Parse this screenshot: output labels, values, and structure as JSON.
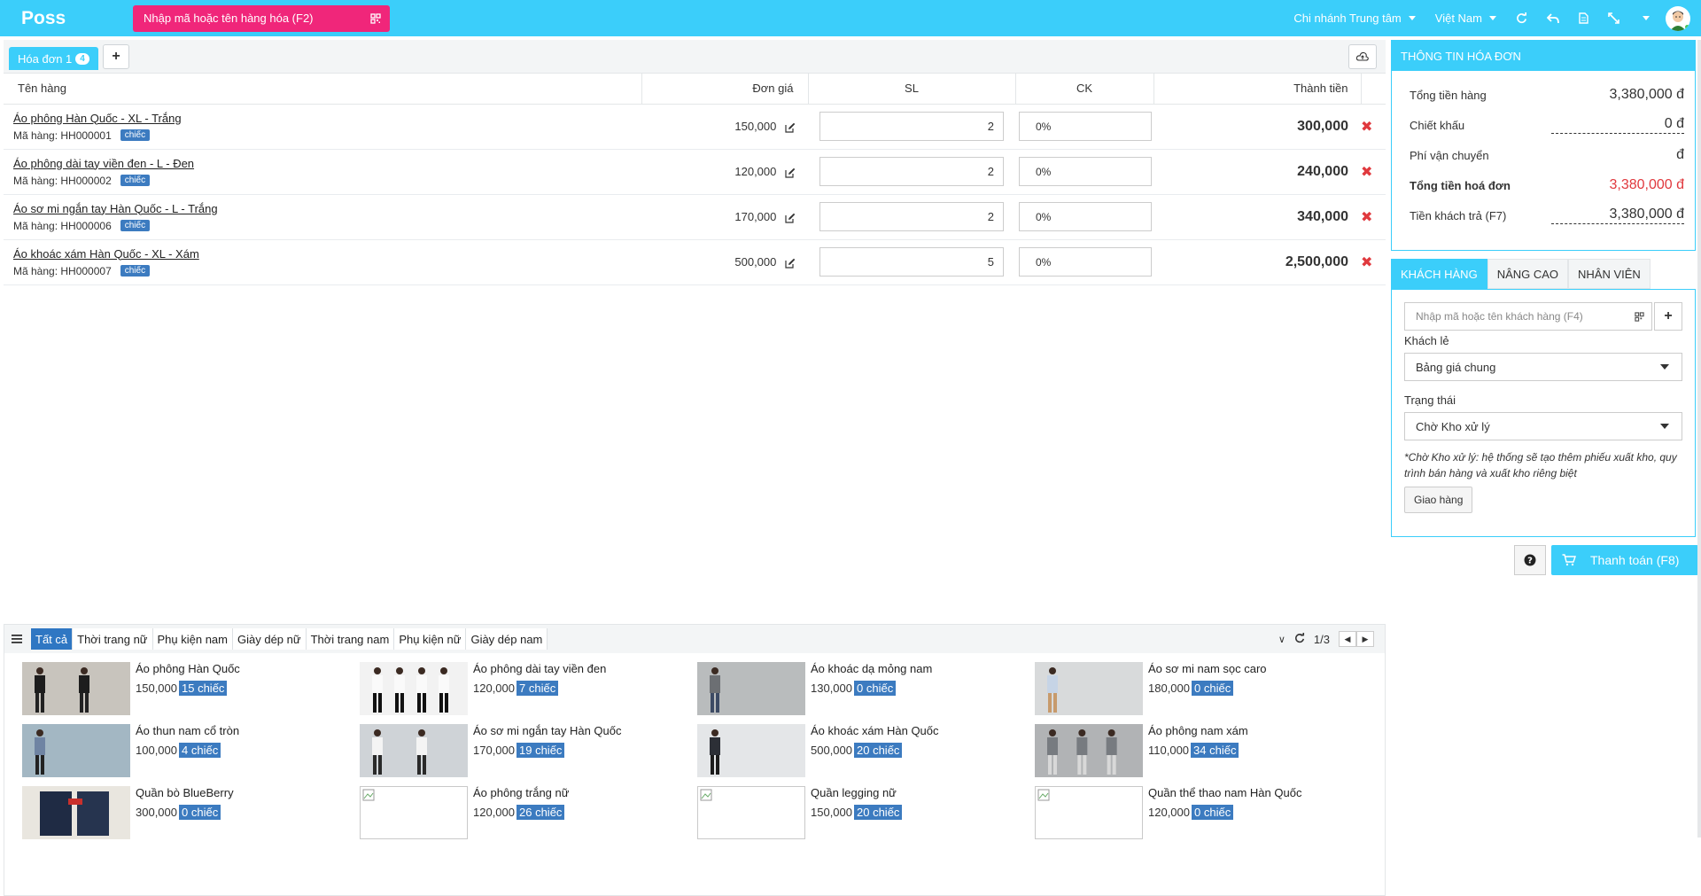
{
  "header": {
    "logo": "Poss",
    "search_placeholder": "Nhập mã hoặc tên hàng hóa (F2)",
    "branch": "Chi nhánh Trung tâm",
    "language": "Việt Nam",
    "icons": [
      "refresh-icon",
      "undo-icon",
      "document-icon",
      "fullscreen-icon",
      "dropdown-icon"
    ]
  },
  "invoice_tab": {
    "label": "Hóa đơn 1",
    "count": "4"
  },
  "cart": {
    "columns": {
      "name": "Tên hàng",
      "price": "Đơn giá",
      "qty": "SL",
      "discount": "CK",
      "total": "Thành tiền"
    },
    "rows": [
      {
        "name": "Áo phông Hàn Quốc - XL - Trắng",
        "code": "Mã hàng: HH000001",
        "unit": "chiếc",
        "price": "150,000",
        "qty": "2",
        "discount": "0%",
        "total": "300,000"
      },
      {
        "name": "Áo phông dài tay viền đen - L - Đen",
        "code": "Mã hàng: HH000002",
        "unit": "chiếc",
        "price": "120,000",
        "qty": "2",
        "discount": "0%",
        "total": "240,000"
      },
      {
        "name": "Áo sơ mi ngắn tay Hàn Quốc - L - Trắng",
        "code": "Mã hàng: HH000006",
        "unit": "chiếc",
        "price": "170,000",
        "qty": "2",
        "discount": "0%",
        "total": "340,000"
      },
      {
        "name": "Áo khoác xám Hàn Quốc - XL - Xám",
        "code": "Mã hàng: HH000007",
        "unit": "chiếc",
        "price": "500,000",
        "qty": "5",
        "discount": "0%",
        "total": "2,500,000"
      }
    ]
  },
  "categories": {
    "items": [
      "Tất cả",
      "Thời trang nữ",
      "Phụ kiện nam",
      "Giày dép nữ",
      "Thời trang nam",
      "Phụ kiện nữ",
      "Giày dép nam"
    ],
    "active": 0,
    "page": "1/3"
  },
  "products": [
    {
      "name": "Áo phông Hàn Quốc",
      "price": "150,000",
      "stock": "15 chiếc",
      "image": "photo-1"
    },
    {
      "name": "Áo phông dài tay viền đen",
      "price": "120,000",
      "stock": "7 chiếc",
      "image": "photo-2"
    },
    {
      "name": "Áo khoác dạ mỏng nam",
      "price": "130,000",
      "stock": "0 chiếc",
      "image": "photo-3"
    },
    {
      "name": "Áo sơ mi nam sọc caro",
      "price": "180,000",
      "stock": "0 chiếc",
      "image": "photo-4"
    },
    {
      "name": "Áo thun nam cổ tròn",
      "price": "100,000",
      "stock": "4 chiếc",
      "image": "photo-5"
    },
    {
      "name": "Áo sơ mi ngắn tay Hàn Quốc",
      "price": "170,000",
      "stock": "19 chiếc",
      "image": "photo-6"
    },
    {
      "name": "Áo khoác xám Hàn Quốc",
      "price": "500,000",
      "stock": "20 chiếc",
      "image": "photo-7"
    },
    {
      "name": "Áo phông nam xám",
      "price": "110,000",
      "stock": "34 chiếc",
      "image": "photo-8"
    },
    {
      "name": "Quần bò BlueBerry",
      "price": "300,000",
      "stock": "0 chiếc",
      "image": "photo-9"
    },
    {
      "name": "Áo phông trắng nữ",
      "price": "120,000",
      "stock": "26 chiếc",
      "image": "broken"
    },
    {
      "name": "Quần legging nữ",
      "price": "150,000",
      "stock": "20 chiếc",
      "image": "broken"
    },
    {
      "name": "Quần thể thao nam Hàn Quốc",
      "price": "120,000",
      "stock": "0 chiếc",
      "image": "broken"
    }
  ],
  "invoice_info": {
    "title": "THÔNG TIN HÓA ĐƠN",
    "rows": [
      {
        "label": "Tổng tiền hàng",
        "value": "3,380,000 đ"
      },
      {
        "label": "Chiết khấu",
        "value": "0 đ"
      },
      {
        "label": "Phí vận chuyển",
        "value": "đ"
      },
      {
        "label": "Tổng tiền hoá đơn",
        "value": "3,380,000 đ"
      },
      {
        "label": "Tiền khách trả (F7)",
        "value": "3,380,000 đ"
      }
    ]
  },
  "customer_tabs": [
    "KHÁCH HÀNG",
    "NÂNG CAO",
    "NHÂN VIÊN"
  ],
  "customer": {
    "search_placeholder": "Nhập mã hoặc tên khách hàng (F4)",
    "type": "Khách lẻ",
    "price_list": "Bảng giá chung",
    "status_label": "Trạng thái",
    "status": "Chờ Kho xử lý",
    "note": "*Chờ Kho xử lý: hệ thống sẽ tạo thêm phiếu xuất kho, quy trình bán hàng và xuất kho riêng biệt",
    "delivery_button": "Giao hàng"
  },
  "pay_button": "Thanh toán (F8)",
  "colors": {
    "accent": "#3bcefa",
    "pink": "#f0267a",
    "tag": "#3c7bc0",
    "danger": "#e0393e"
  }
}
